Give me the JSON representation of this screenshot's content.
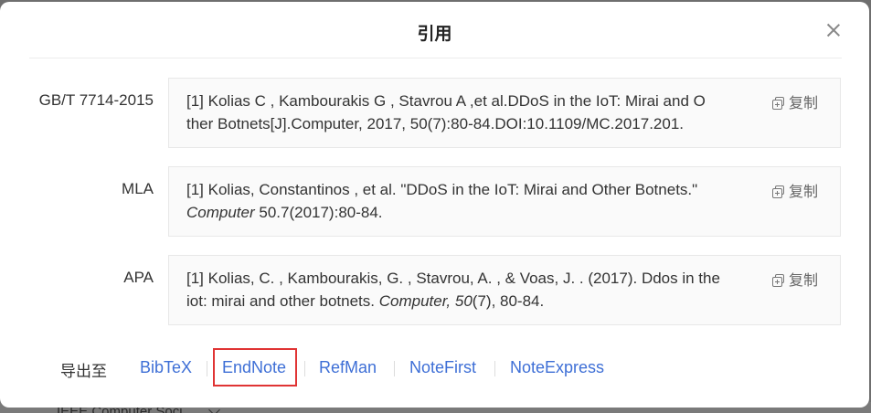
{
  "dialog": {
    "title": "引用",
    "close_icon": "close-icon"
  },
  "citations": [
    {
      "format": "GB/T 7714-2015",
      "line1": "[1] Kolias C , Kambourakis G , Stavrou A ,et al.DDoS in the IoT: Mirai and O",
      "line2": "ther Botnets[J].Computer, 2017, 50(7):80-84.DOI:10.1109/MC.2017.201.",
      "copy_label": "复制"
    },
    {
      "format": "MLA",
      "line1": "[1] Kolias, Constantinos , et al. \"DDoS in the IoT: Mirai and Other Botnets.\"",
      "line2_italic": "Computer",
      "line2_rest": " 50.7(2017):80-84.",
      "copy_label": "复制"
    },
    {
      "format": "APA",
      "line1": "[1] Kolias, C. , Kambourakis, G. , Stavrou, A. , & Voas, J. . (2017). Ddos in the",
      "line2_pre": "iot: mirai and other botnets. ",
      "line2_italic": "Computer, 50",
      "line2_rest": "(7), 80-84.",
      "copy_label": "复制"
    }
  ],
  "export": {
    "label": "导出至",
    "links": [
      "BibTeX",
      "EndNote",
      "RefMan",
      "NoteFirst",
      "NoteExpress"
    ],
    "highlighted": "EndNote"
  },
  "background": {
    "partial_text": "IEEE Computer Soci"
  },
  "colors": {
    "link": "#3e6fd6",
    "highlight": "#e03434",
    "overlay": "#6f6f6f"
  }
}
